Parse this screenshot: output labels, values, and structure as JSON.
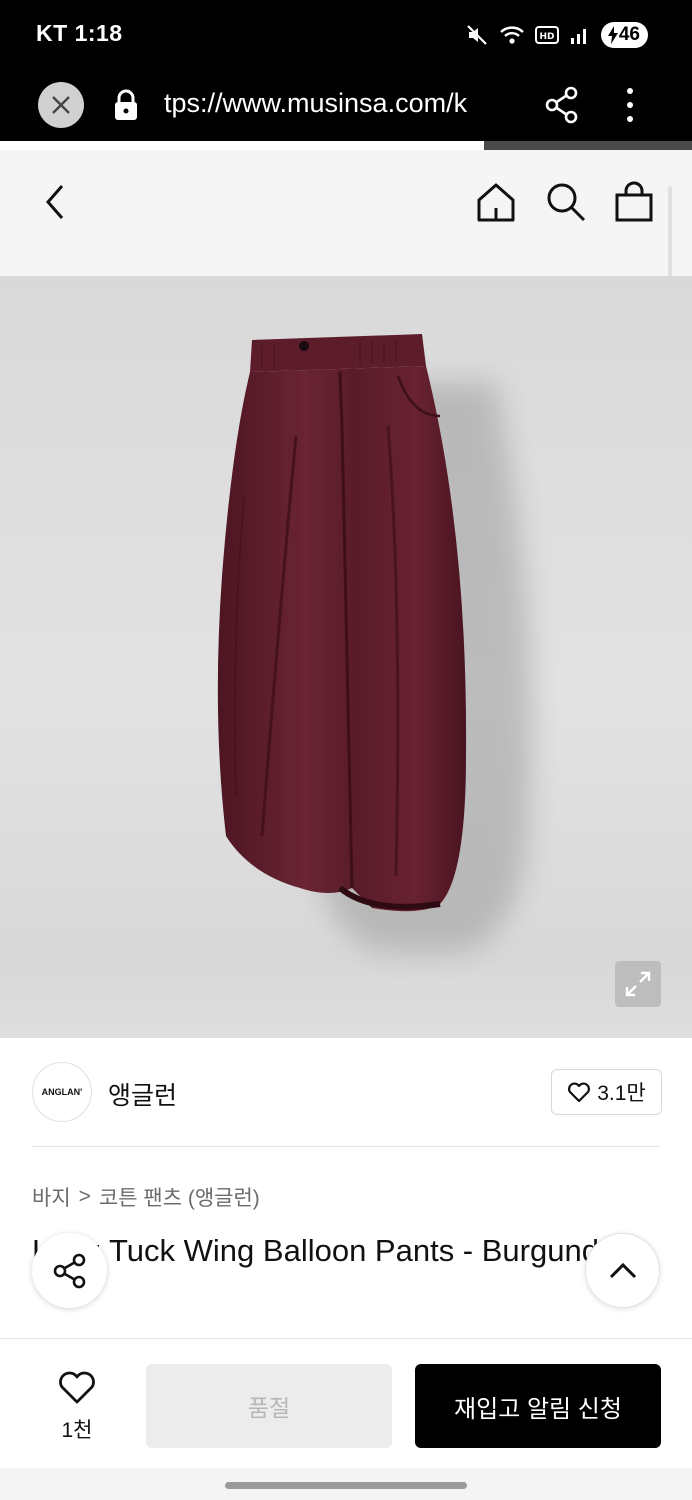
{
  "status_bar": {
    "carrier": "KT",
    "time": "1:18",
    "battery": "46"
  },
  "browser": {
    "url": "tps://www.musinsa.com/k"
  },
  "brand": {
    "logo_text": "ANGLAN'",
    "name": "앵글런",
    "likes": "3.1만"
  },
  "breadcrumb": {
    "category": "바지",
    "separator": ">",
    "subcategory": "코튼 팬츠 (앵글런)"
  },
  "product": {
    "title": "Long Tuck Wing Balloon Pants - Burgundy",
    "color": "#5e1e2c"
  },
  "bottom_bar": {
    "wish_count": "1천",
    "soldout_label": "품절",
    "restock_label": "재입고 알림 신청"
  },
  "colors": {
    "primary_button": "#000000",
    "disabled_button": "#ececec"
  }
}
